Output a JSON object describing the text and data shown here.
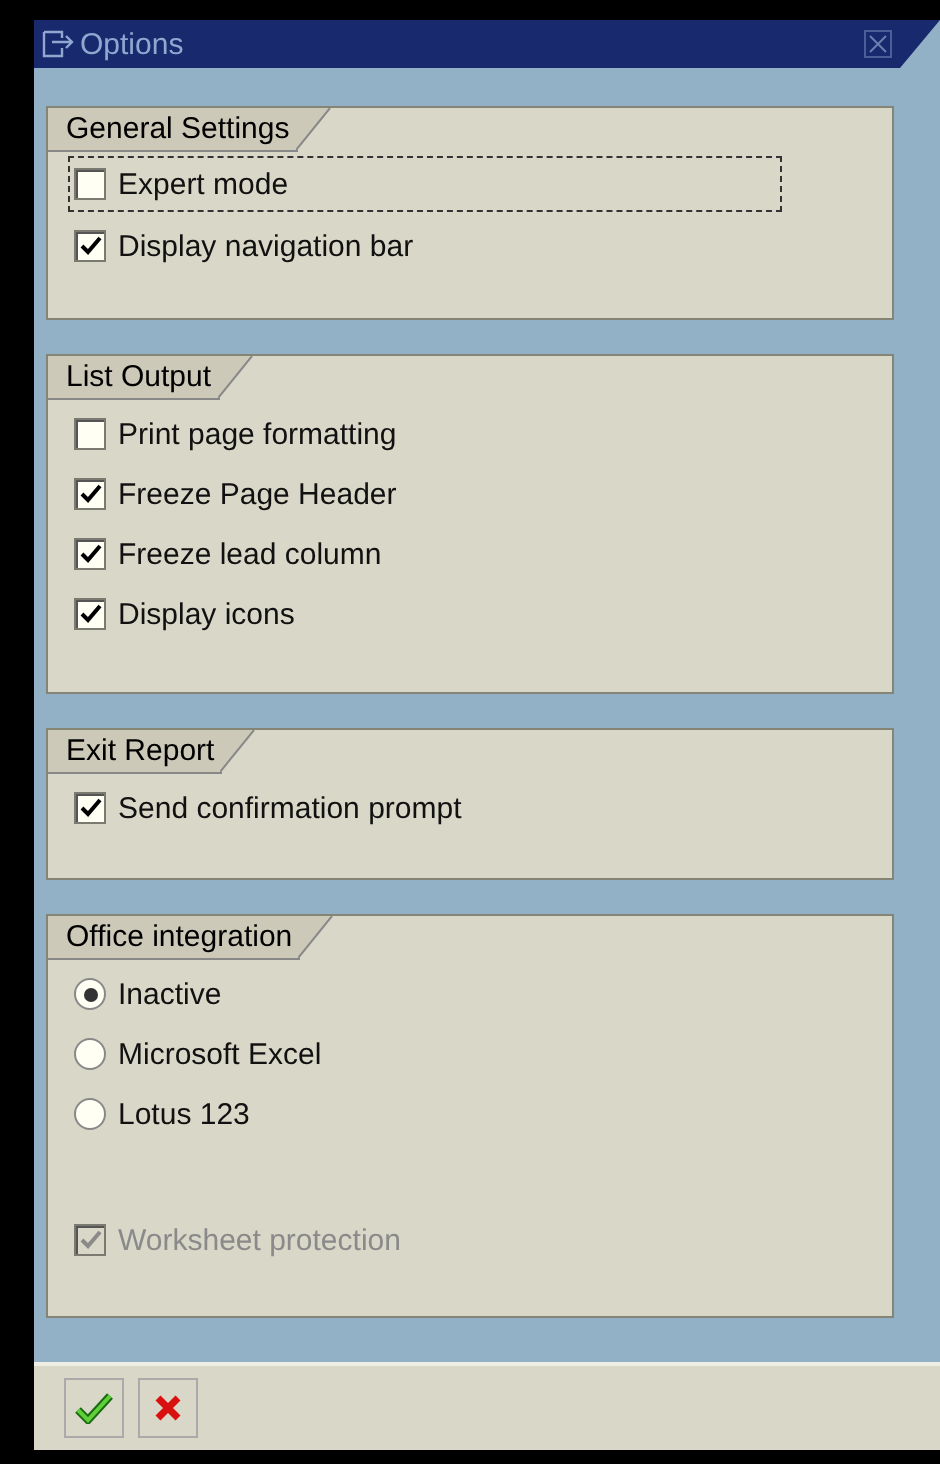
{
  "window": {
    "title": "Options"
  },
  "groups": [
    {
      "title": "General Settings",
      "items": [
        {
          "kind": "checkbox",
          "label": "Expert mode",
          "checked": false,
          "focused": true,
          "disabled": false
        },
        {
          "kind": "checkbox",
          "label": "Display navigation bar",
          "checked": true,
          "focused": false,
          "disabled": false
        }
      ]
    },
    {
      "title": "List Output",
      "items": [
        {
          "kind": "checkbox",
          "label": "Print page formatting",
          "checked": false,
          "focused": false,
          "disabled": false
        },
        {
          "kind": "checkbox",
          "label": "Freeze Page Header",
          "checked": true,
          "focused": false,
          "disabled": false
        },
        {
          "kind": "checkbox",
          "label": "Freeze lead column",
          "checked": true,
          "focused": false,
          "disabled": false
        },
        {
          "kind": "checkbox",
          "label": "Display icons",
          "checked": true,
          "focused": false,
          "disabled": false
        }
      ]
    },
    {
      "title": "Exit Report",
      "items": [
        {
          "kind": "checkbox",
          "label": "Send confirmation prompt",
          "checked": true,
          "focused": false,
          "disabled": false
        }
      ]
    },
    {
      "title": "Office integration",
      "items": [
        {
          "kind": "radio",
          "label": "Inactive",
          "selected": true,
          "disabled": false
        },
        {
          "kind": "radio",
          "label": "Microsoft Excel",
          "selected": false,
          "disabled": false
        },
        {
          "kind": "radio",
          "label": "Lotus 123",
          "selected": false,
          "disabled": false
        },
        {
          "kind": "spacer"
        },
        {
          "kind": "checkbox",
          "label": "Worksheet protection",
          "checked": true,
          "focused": false,
          "disabled": true
        }
      ]
    }
  ],
  "buttons": [
    {
      "kind": "ok"
    },
    {
      "kind": "cancel"
    }
  ]
}
